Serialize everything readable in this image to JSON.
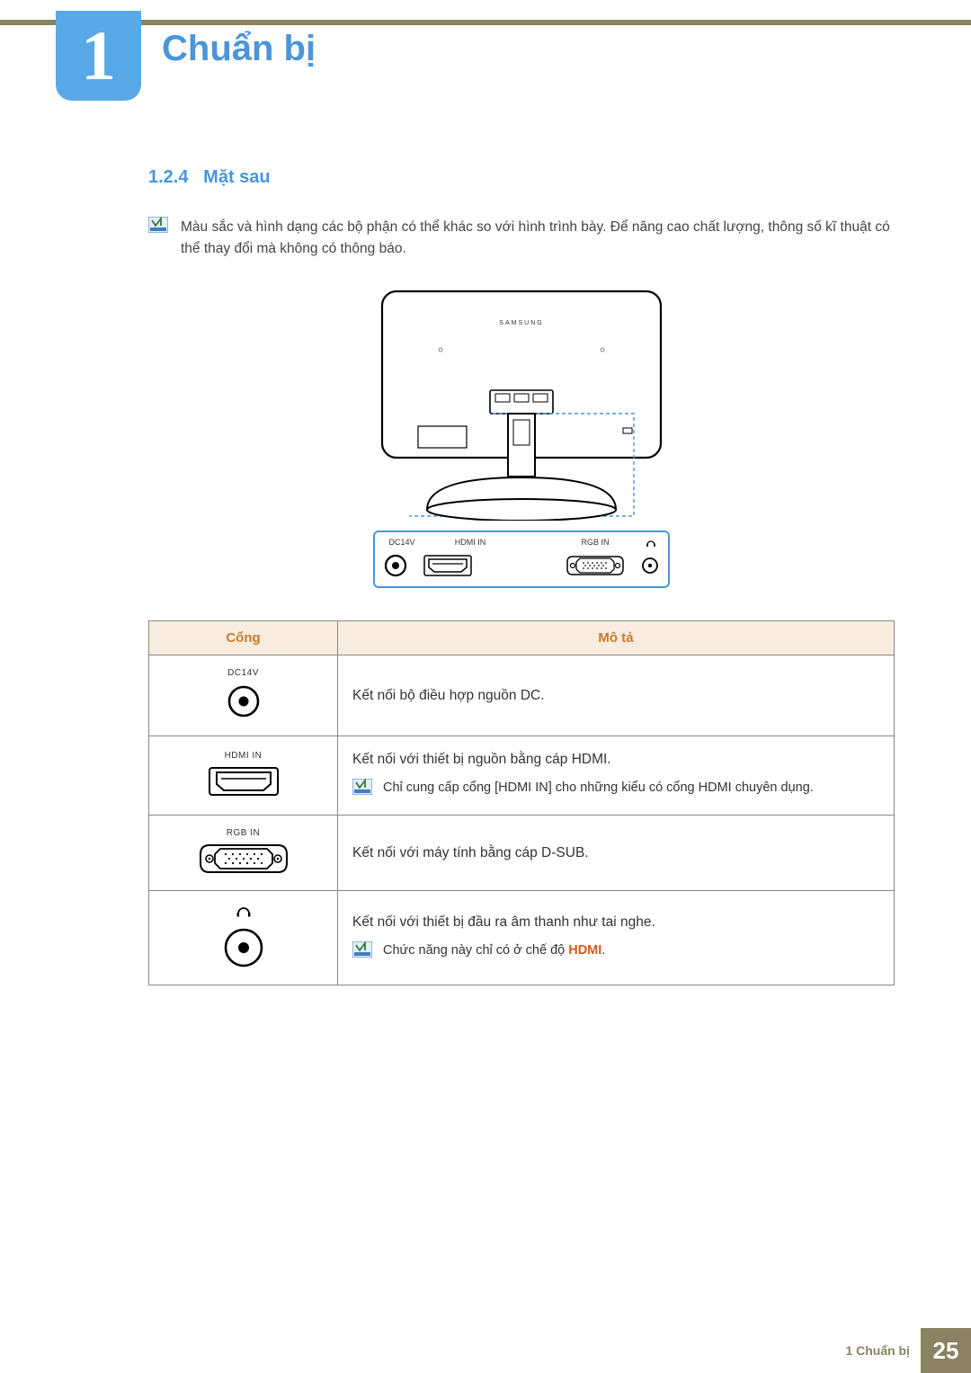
{
  "chapter": {
    "number": "1",
    "title": "Chuẩn bị"
  },
  "section": {
    "number": "1.2.4",
    "title": "Mặt sau"
  },
  "intro_note": "Màu sắc và hình dạng các bộ phận có thể khác so với hình trình bày. Để nâng cao chất lượng, thông số kĩ thuật có thể thay đổi mà không có thông báo.",
  "diagram": {
    "brand": "SAMSUNG",
    "port_labels": {
      "dc": "DC14V",
      "hdmi": "HDMI IN",
      "rgb": "RGB IN"
    }
  },
  "table": {
    "col1": "Cổng",
    "col2": "Mô tả",
    "rows": [
      {
        "label": "DC14V",
        "icon": "dc-jack",
        "desc": "Kết nối bộ điều hợp nguồn DC.",
        "note": ""
      },
      {
        "label": "HDMI IN",
        "icon": "hdmi",
        "desc": "Kết nối với thiết bị nguồn bằng cáp HDMI.",
        "note": "Chỉ cung cấp cổng [HDMI IN] cho những kiểu có cổng HDMI chuyên dụng."
      },
      {
        "label": "RGB IN",
        "icon": "vga",
        "desc": "Kết nối với máy tính bằng cáp D-SUB.",
        "note": ""
      },
      {
        "label": "",
        "icon": "headphone",
        "desc": "Kết nối với thiết bị đầu ra âm thanh như tai nghe.",
        "note_pre": "Chức năng này chỉ có ở chế độ ",
        "note_emph": "HDMI",
        "note_post": "."
      }
    ]
  },
  "footer": {
    "label": "1 Chuẩn bị",
    "page": "25"
  }
}
